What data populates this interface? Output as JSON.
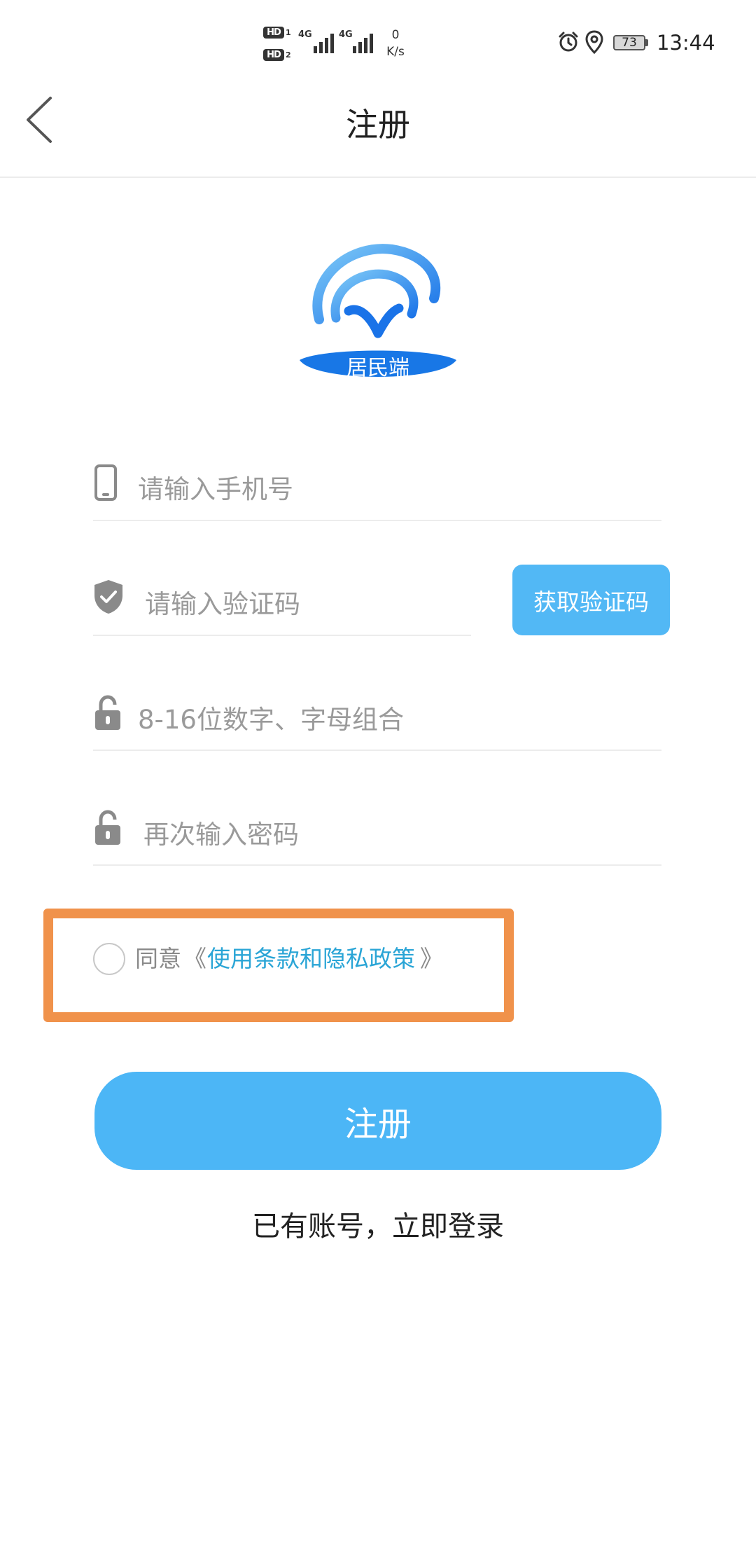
{
  "status_bar": {
    "sim1_badge": "HD",
    "sim1_num": "1",
    "sim2_badge": "HD",
    "sim2_num": "2",
    "net1": "4G",
    "net2": "4G",
    "speed_value": "0",
    "speed_unit": "K/s",
    "battery_level": "73",
    "time": "13:44",
    "icons": [
      "alarm-icon",
      "location-icon",
      "battery-icon"
    ]
  },
  "header": {
    "title": "注册",
    "back_icon": "chevron-left-icon"
  },
  "logo": {
    "badge_text": "居民端",
    "colors": {
      "arc_dark": "#1a73e8",
      "arc_light": "#6ec1f7",
      "ribbon": "#1877e6"
    }
  },
  "form": {
    "phone_placeholder": "请输入手机号",
    "code_placeholder": "请输入验证码",
    "get_code_label": "获取验证码",
    "password_placeholder": "8-16位数字、字母组合",
    "confirm_password_placeholder": "再次输入密码"
  },
  "agreement": {
    "prefix": "同意",
    "open_bracket": "《",
    "link_text": "使用条款和隐私政策",
    "close_bracket": "》",
    "checked": false
  },
  "actions": {
    "register_label": "注册",
    "login_link": "已有账号，立即登录"
  },
  "colors": {
    "accent": "#4cb6f6",
    "link": "#2aa5d6",
    "highlight_box": "#f0924b",
    "placeholder": "#9a9a9a"
  }
}
